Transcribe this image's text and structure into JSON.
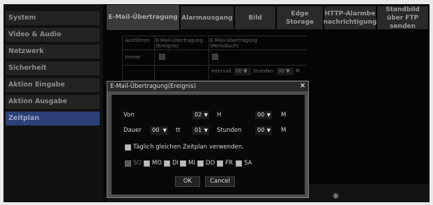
{
  "sidebar": {
    "items": [
      {
        "label": "System"
      },
      {
        "label": "Video & Audio"
      },
      {
        "label": "Netzwerk"
      },
      {
        "label": "Sicherheit"
      },
      {
        "label": "Aktion Eingabe"
      },
      {
        "label": "Aktion Ausgabe"
      },
      {
        "label": "Zeitplan",
        "active": true
      }
    ]
  },
  "tabs": [
    {
      "label": "E-Mail-Übertragung",
      "active": true
    },
    {
      "label": "Alarmausgang"
    },
    {
      "label": "Bild"
    },
    {
      "label": "Edge Storage"
    },
    {
      "label": "HTTP-Alarmbe nachrichtigung"
    },
    {
      "label": "Standbild über FTP senden"
    }
  ],
  "background_table": {
    "col_execute": "Ausführen",
    "col_event": "E-Mail-Übertragung (Ereignis)",
    "col_periodic": "E-Mail-Übertragung (Periodisch)",
    "row_always": "Immer",
    "interval_label": "Intervall",
    "interval_value": "00",
    "hours_label": "Stunden",
    "minutes_value": "30",
    "minutes_label": "M"
  },
  "dialog": {
    "title": "E-Mail-Übertragung(Ereignis)",
    "close": "✕",
    "from_label": "Von",
    "from_hour": "02",
    "hour_unit": "H",
    "from_min": "00",
    "min_unit": "M",
    "duration_label": "Dauer",
    "duration_days": "00",
    "days_unit": "tt",
    "duration_hours": "01",
    "hours_unit": "Stunden",
    "duration_min": "00",
    "duration_min_unit": "M",
    "same_schedule_label": "Täglich gleichen Zeitplan verwenden.",
    "days": [
      "SO",
      "MO",
      "DI",
      "MI",
      "DO",
      "FR",
      "SA"
    ],
    "ok_label": "OK",
    "cancel_label": "Cancel",
    "arrow": "▼"
  }
}
